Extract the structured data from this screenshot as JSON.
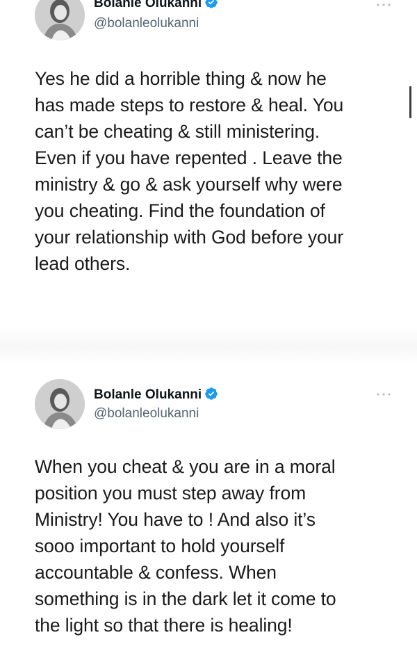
{
  "tweets": [
    {
      "display_name": "Bolanle Olukanni",
      "handle": "@bolanleolukanni",
      "verified": true,
      "text": "Yes he did a horrible thing &  now he\nhas made steps to restore & heal. You\ncan’t be cheating & still ministering.\nEven if you have repented . Leave the\nministry & go & ask yourself why were\nyou cheating. Find the foundation of\nyour relationship with God before your\nlead others."
    },
    {
      "display_name": "Bolanle Olukanni",
      "handle": "@bolanleolukanni",
      "verified": true,
      "text": "When you cheat & you are in a moral\nposition you must step away from\nMinistry! You have to ! And also it’s\nsooo important to hold yourself\naccountable & confess. When\nsomething is in the dark let it come to\nthe light so that there is healing!"
    }
  ],
  "icons": {
    "verified": "verified-badge-icon",
    "more": "more-options-icon",
    "avatar": "profile-photo"
  },
  "colors": {
    "verified_blue": "#1d9bf0",
    "handle_gray": "#536471",
    "text": "#0f1419"
  }
}
